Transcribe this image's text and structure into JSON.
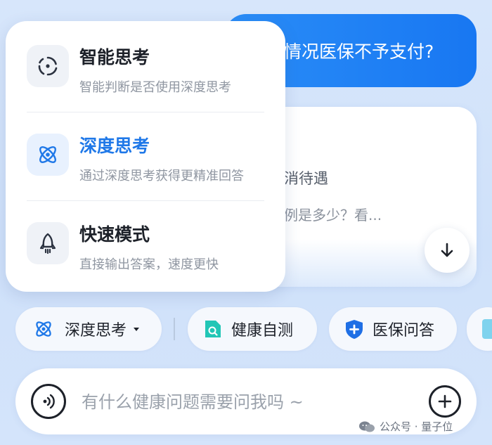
{
  "conversation": {
    "user_message": "情况医保不予支付?",
    "answer_line1": "消待遇",
    "answer_line2": "例是多少？看..."
  },
  "mode_menu": {
    "items": [
      {
        "title": "智能思考",
        "desc": "智能判断是否使用深度思考",
        "icon": "auto-think-icon",
        "active": false
      },
      {
        "title": "深度思考",
        "desc": "通过深度思考获得更精准回答",
        "icon": "atom-icon",
        "active": true
      },
      {
        "title": "快速模式",
        "desc": "直接输出答案，速度更快",
        "icon": "rocket-icon",
        "active": false
      }
    ]
  },
  "chips": {
    "mode_selector": "深度思考",
    "health_check": "健康自测",
    "insurance_qa": "医保问答"
  },
  "input": {
    "placeholder": "有什么健康问题需要问我吗 ~"
  },
  "watermark": {
    "text": "公众号 · 量子位"
  },
  "colors": {
    "accent": "#1f78e8",
    "user_bubble": "#1877f2",
    "background": "#d7e6fb",
    "health_chip_icon": "#22c6b6",
    "insurance_chip_icon": "#1f6fe5"
  }
}
